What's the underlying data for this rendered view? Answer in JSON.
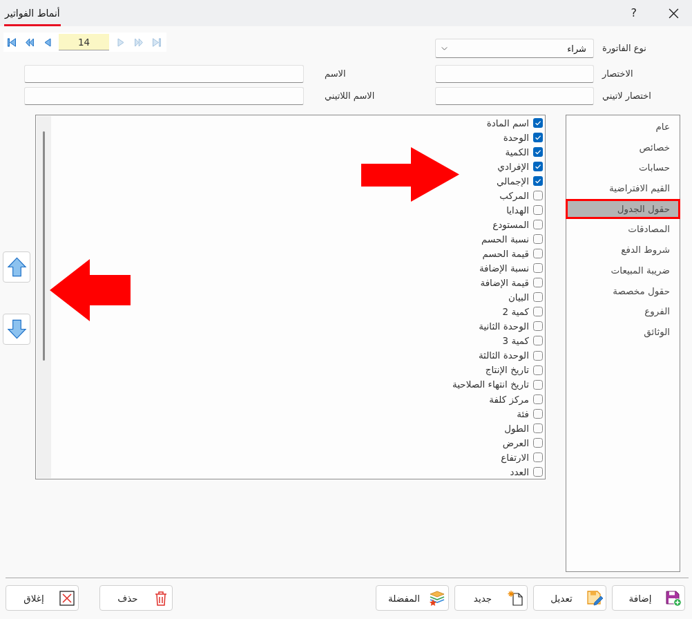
{
  "window": {
    "tabs": [
      {
        "label": "أنماط الفواتير",
        "selected": true
      }
    ],
    "help": "?"
  },
  "navigator": {
    "back": [
      {
        "kind": "first",
        "disabled": false
      },
      {
        "kind": "previous_page",
        "disabled": false
      },
      {
        "kind": "previous",
        "disabled": false
      }
    ],
    "record": "14",
    "forward": [
      {
        "kind": "next",
        "disabled": true
      },
      {
        "kind": "next_page",
        "disabled": true
      },
      {
        "kind": "last",
        "disabled": true
      }
    ]
  },
  "invoice_type": {
    "label": "نوع الفاتورة",
    "value": "شراء"
  },
  "fields": [
    {
      "label": "الاختصار"
    },
    {
      "label": "الاسم"
    },
    {
      "label": "اختصار لاتيني"
    },
    {
      "label": "الاسم اللاتيني"
    }
  ],
  "sections": [
    {
      "label": "عام",
      "selected": false
    },
    {
      "label": "خصائص",
      "selected": false
    },
    {
      "label": "حسابات",
      "selected": false
    },
    {
      "label": "القيم الافتراضية",
      "selected": false
    },
    {
      "label": "حقول الجدول",
      "selected": true
    },
    {
      "label": "المصادقات",
      "selected": false
    },
    {
      "label": "شروط الدفع",
      "selected": false
    },
    {
      "label": "ضريبة المبيعات",
      "selected": false
    },
    {
      "label": "حقول مخصصة",
      "selected": false
    },
    {
      "label": "الفروع",
      "selected": false
    },
    {
      "label": "الوثائق",
      "selected": false
    }
  ],
  "columns": [
    {
      "label": "اسم المادة",
      "checked": true
    },
    {
      "label": "الوحدة",
      "checked": true
    },
    {
      "label": "الكمية",
      "checked": true
    },
    {
      "label": "الإفرادي",
      "checked": true
    },
    {
      "label": "الإجمالي",
      "checked": true
    },
    {
      "label": "المركب",
      "checked": false
    },
    {
      "label": "الهدايا",
      "checked": false
    },
    {
      "label": "المستودع",
      "checked": false
    },
    {
      "label": "نسبة الحسم",
      "checked": false
    },
    {
      "label": "قيمة الحسم",
      "checked": false
    },
    {
      "label": "نسبة الإضافة",
      "checked": false
    },
    {
      "label": "قيمة الإضافة",
      "checked": false
    },
    {
      "label": "البيان",
      "checked": false
    },
    {
      "label": "كمية 2",
      "checked": false
    },
    {
      "label": "الوحدة الثانية",
      "checked": false
    },
    {
      "label": "كمية 3",
      "checked": false
    },
    {
      "label": "الوحدة الثالثة",
      "checked": false
    },
    {
      "label": "تاريخ الإنتاج",
      "checked": false
    },
    {
      "label": "تاريخ انتهاء الصلاحية",
      "checked": false
    },
    {
      "label": "مركز كلفة",
      "checked": false
    },
    {
      "label": "فئة",
      "checked": false
    },
    {
      "label": "الطول",
      "checked": false
    },
    {
      "label": "العرض",
      "checked": false
    },
    {
      "label": "الارتفاع",
      "checked": false
    },
    {
      "label": "العدد",
      "checked": false
    }
  ],
  "record_actions": [
    {
      "kind": "add",
      "label": "إضافة"
    },
    {
      "kind": "edit",
      "label": "تعديل"
    },
    {
      "kind": "new",
      "label": "جديد"
    },
    {
      "kind": "favorites",
      "label": "المفضلة"
    }
  ],
  "dialog_actions": [
    {
      "kind": "delete",
      "label": "حذف"
    },
    {
      "kind": "close",
      "label": "إغلاق"
    }
  ]
}
